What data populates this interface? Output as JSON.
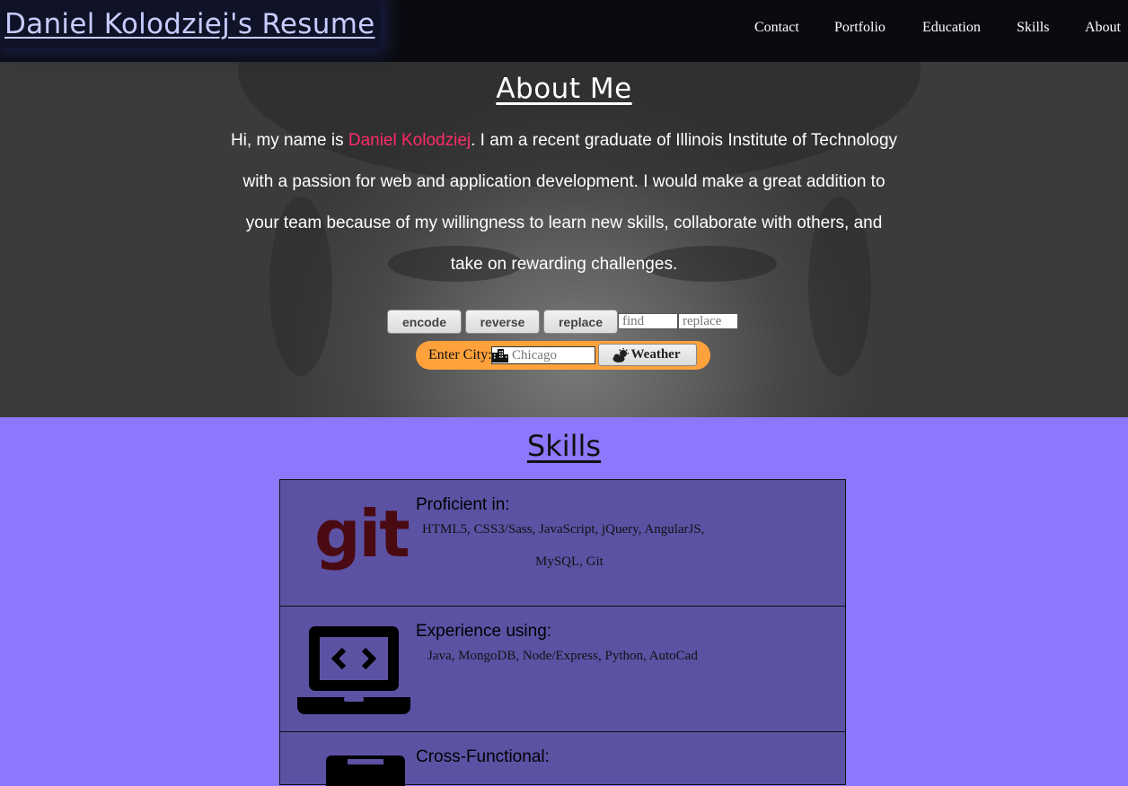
{
  "nav": {
    "brand": "Daniel Kolodziej's Resume",
    "links": [
      "Contact",
      "Portfolio",
      "Education",
      "Skills",
      "About"
    ]
  },
  "about": {
    "title": "About Me",
    "intro_prefix": "Hi, my name is ",
    "intro_name": "Daniel Kolodziej",
    "intro_suffix": ". I am a recent graduate of Illinois Institute of Technology",
    "lines": [
      "with a passion for web and application development. I would make a great addition to",
      "your team because of my willingness to learn new skills, collaborate with others, and",
      "take on rewarding challenges."
    ],
    "name_color": "#ff2a6a"
  },
  "tools": {
    "encode_label": "encode",
    "reverse_label": "reverse",
    "replace_label": "replace",
    "find_placeholder": "find",
    "replace_placeholder": "replace"
  },
  "weather": {
    "city_label": "Enter City:",
    "city_placeholder": "Chicago",
    "button_label": "Weather",
    "city_icon": "city-icon",
    "button_icon": "weather-icon",
    "pill_color": "#ffa23c"
  },
  "skills": {
    "title": "Skills",
    "cards": [
      {
        "icon": "git-icon",
        "logo_text": "git",
        "heading": "Proficient in:",
        "line1": "HTML5, CSS3/Sass, JavaScript, jQuery, AngularJS,",
        "line2": "MySQL, Git"
      },
      {
        "icon": "laptop-code-icon",
        "heading": "Experience using:",
        "line1": "Java, MongoDB, Node/Express, Python, AutoCad"
      },
      {
        "icon": "briefcase-icon",
        "heading": "Cross-Functional:"
      }
    ],
    "background_color": "#8b78fc",
    "card_color": "#5c52a4"
  }
}
